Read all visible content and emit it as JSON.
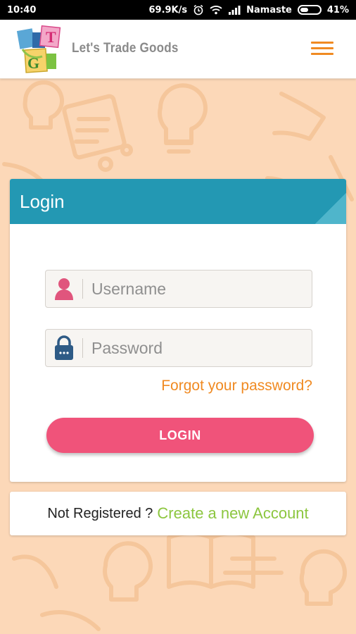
{
  "status_bar": {
    "time": "10:40",
    "network_speed": "69.9K/s",
    "carrier": "Namaste",
    "battery_percent": "41%",
    "battery_level": 0.41
  },
  "header": {
    "brand_name": "Let's Trade Goods",
    "logo_letters": [
      "T",
      "G"
    ],
    "menu_icon": "hamburger-menu-icon",
    "accent_color": "#f08a22"
  },
  "login": {
    "title": "Login",
    "header_color": "#2398b3",
    "username_placeholder": "Username",
    "password_placeholder": "Password",
    "forgot_password": "Forgot your password?",
    "submit_label": "LOGIN",
    "button_color": "#f0537a"
  },
  "register": {
    "prompt": "Not Registered ?",
    "link": "Create a new Account",
    "link_color": "#8cc63f"
  }
}
